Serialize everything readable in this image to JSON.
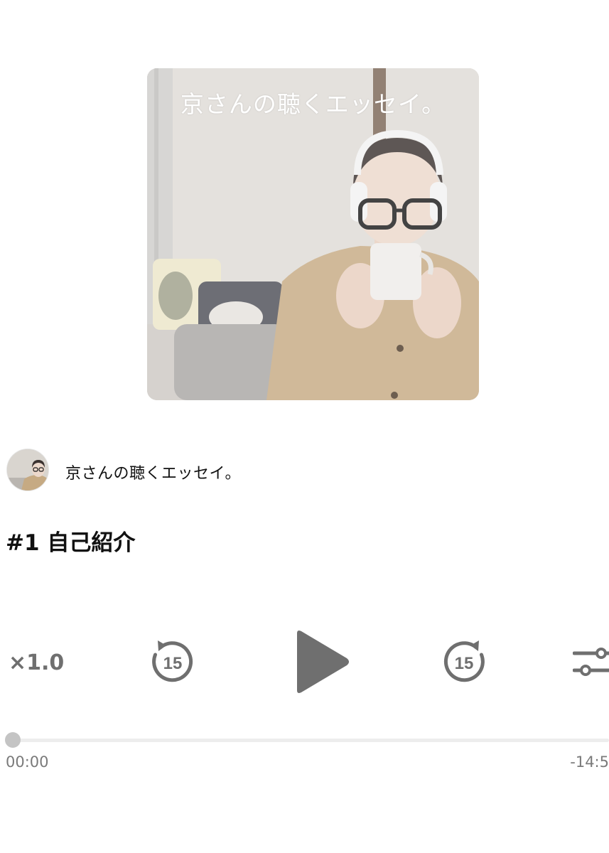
{
  "podcast": {
    "cover_title": "京さんの聴くエッセイ。",
    "channel_name": "京さんの聴くエッセイ。"
  },
  "episode": {
    "title": "#1 自己紹介"
  },
  "player": {
    "speed_label": "×1.0",
    "rewind_seconds": "15",
    "forward_seconds": "15",
    "elapsed": "00:00",
    "remaining": "-14:5",
    "progress_fraction": 0.0,
    "icons": {
      "rewind": "rewind-15-icon",
      "play": "play-icon",
      "forward": "forward-15-icon",
      "settings": "sliders-icon"
    },
    "accent_color": "#6f6f6f"
  }
}
